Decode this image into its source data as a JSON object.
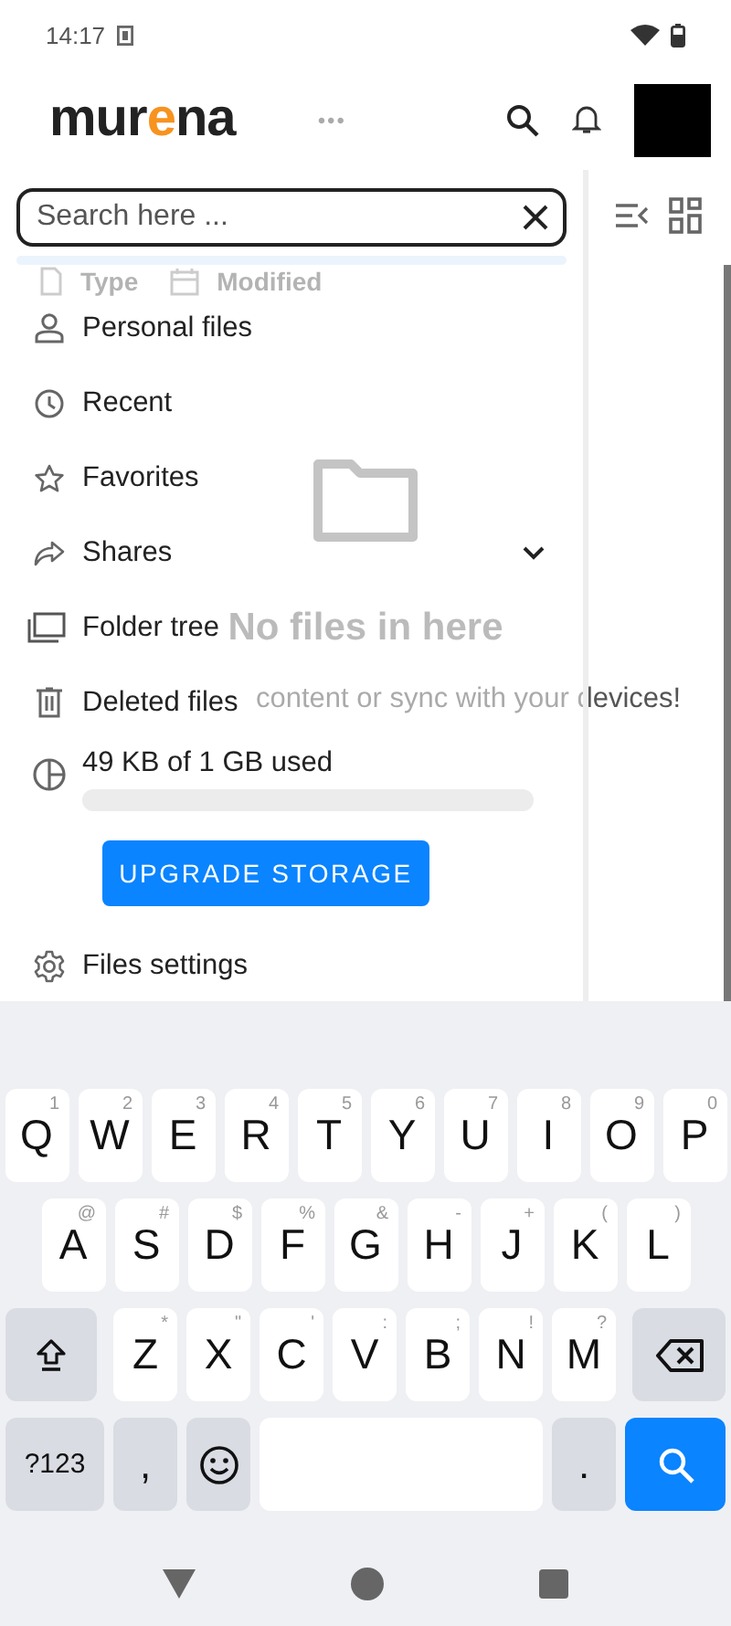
{
  "status_bar": {
    "time": "14:17"
  },
  "header": {
    "logo": "murena",
    "more": "•••"
  },
  "filters": [
    {
      "label": "Type",
      "kind": "type"
    },
    {
      "label": "Modified",
      "kind": "date"
    }
  ],
  "empty_state": {
    "title": "No files in here",
    "subtitle": "content or sync with your devices!"
  },
  "drawer": {
    "search": {
      "placeholder": "Search here ..."
    },
    "items": [
      {
        "label": "Personal files",
        "kind": "person",
        "expandable": false
      },
      {
        "label": "Recent",
        "kind": "clock",
        "expandable": false
      },
      {
        "label": "Favorites",
        "kind": "star",
        "expandable": false
      },
      {
        "label": "Shares",
        "kind": "share",
        "expandable": true
      },
      {
        "label": "Folder tree",
        "kind": "folders",
        "expandable": false
      },
      {
        "label": "Deleted files",
        "kind": "trash",
        "expandable": false
      }
    ],
    "storage": {
      "label": "49 KB of 1 GB used",
      "level": 0.0
    },
    "upgrade_button": "UPGRADE STORAGE",
    "settings": "Files settings"
  },
  "keyboard": {
    "rows": [
      {
        "keys": [
          {
            "kind": "letter",
            "label": "Q",
            "hint": "1"
          },
          {
            "kind": "letter",
            "label": "W",
            "hint": "2"
          },
          {
            "kind": "letter",
            "label": "E",
            "hint": "3"
          },
          {
            "kind": "letter",
            "label": "R",
            "hint": "4"
          },
          {
            "kind": "letter",
            "label": "T",
            "hint": "5"
          },
          {
            "kind": "letter",
            "label": "Y",
            "hint": "6"
          },
          {
            "kind": "letter",
            "label": "U",
            "hint": "7"
          },
          {
            "kind": "letter",
            "label": "I",
            "hint": "8"
          },
          {
            "kind": "letter",
            "label": "O",
            "hint": "9"
          },
          {
            "kind": "letter",
            "label": "P",
            "hint": "0"
          }
        ]
      },
      {
        "keys": [
          {
            "kind": "letter",
            "label": "A",
            "hint": "@"
          },
          {
            "kind": "letter",
            "label": "S",
            "hint": "#"
          },
          {
            "kind": "letter",
            "label": "D",
            "hint": "$"
          },
          {
            "kind": "letter",
            "label": "F",
            "hint": "%"
          },
          {
            "kind": "letter",
            "label": "G",
            "hint": "&"
          },
          {
            "kind": "letter",
            "label": "H",
            "hint": "-"
          },
          {
            "kind": "letter",
            "label": "J",
            "hint": "+"
          },
          {
            "kind": "letter",
            "label": "K",
            "hint": "("
          },
          {
            "kind": "letter",
            "label": "L",
            "hint": ")"
          }
        ]
      },
      {
        "keys": [
          {
            "kind": "shift"
          },
          {
            "kind": "letter",
            "label": "Z",
            "hint": "*"
          },
          {
            "kind": "letter",
            "label": "X",
            "hint": "\""
          },
          {
            "kind": "letter",
            "label": "C",
            "hint": "'"
          },
          {
            "kind": "letter",
            "label": "V",
            "hint": ":"
          },
          {
            "kind": "letter",
            "label": "B",
            "hint": ";"
          },
          {
            "kind": "letter",
            "label": "N",
            "hint": "!"
          },
          {
            "kind": "letter",
            "label": "M",
            "hint": "?"
          },
          {
            "kind": "backspace"
          }
        ]
      },
      {
        "keys": [
          {
            "kind": "mode",
            "label": "?123"
          },
          {
            "kind": "comma",
            "label": ","
          },
          {
            "kind": "emoji"
          },
          {
            "kind": "space"
          },
          {
            "kind": "period",
            "label": "."
          },
          {
            "kind": "search"
          }
        ]
      }
    ]
  }
}
